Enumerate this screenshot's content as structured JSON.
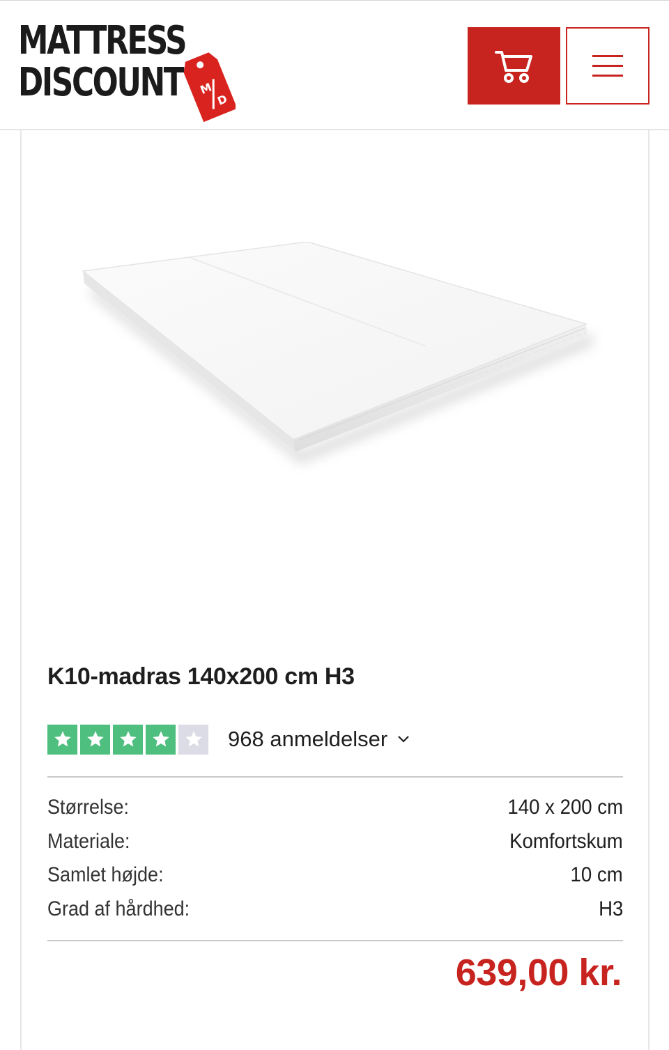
{
  "header": {
    "logo": {
      "line1": "MATTRESS",
      "line2": "DISCOUNT",
      "tag_text": "M/D"
    },
    "cart_icon": "shopping-cart-icon",
    "menu_icon": "hamburger-menu-icon",
    "accent_color": "#c8241f"
  },
  "product": {
    "image_subject": "mattress",
    "title": "K10-madras 140x200 cm H3",
    "rating": {
      "stars": 4,
      "max_stars": 5,
      "star_color": "#00b67a",
      "review_count_label": "968 anmeldelser"
    },
    "specs": [
      {
        "label": "Størrelse:",
        "value": "140 x 200 cm"
      },
      {
        "label": "Materiale:",
        "value": "Komfortskum"
      },
      {
        "label": "Samlet højde:",
        "value": "10 cm"
      },
      {
        "label": "Grad af hårdhed:",
        "value": "H3"
      }
    ],
    "price": "639,00 kr.",
    "price_color": "#c8241f"
  }
}
